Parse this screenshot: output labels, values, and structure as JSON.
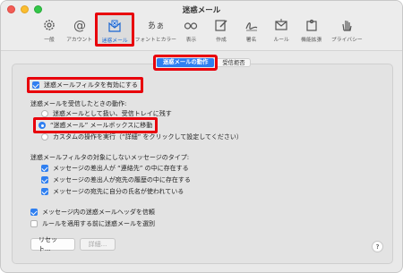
{
  "window": {
    "title": "迷惑メール"
  },
  "toolbar": {
    "items": [
      {
        "label": "一般",
        "icon": "gear-icon"
      },
      {
        "label": "アカウント",
        "icon": "at-sign-icon"
      },
      {
        "label": "迷惑メール",
        "icon": "junk-mail-icon",
        "active": true
      },
      {
        "label": "フォントとカラー",
        "icon": "fonts-icon"
      },
      {
        "label": "表示",
        "icon": "glasses-icon"
      },
      {
        "label": "作成",
        "icon": "compose-icon"
      },
      {
        "label": "署名",
        "icon": "signature-icon"
      },
      {
        "label": "ルール",
        "icon": "rules-icon"
      },
      {
        "label": "機能拡張",
        "icon": "extensions-icon"
      },
      {
        "label": "プライバシー",
        "icon": "hand-icon"
      }
    ]
  },
  "tabs": {
    "active": "迷惑メールの動作",
    "other": "受信拒否"
  },
  "filter": {
    "label": "迷惑メールフィルタを有効にする",
    "checked": true
  },
  "received": {
    "heading": "迷惑メールを受信したときの動作:",
    "options": [
      {
        "label": "迷惑メールとして扱い、受信トレイに残す",
        "selected": false
      },
      {
        "label": "“迷惑メール” メールボックスに移動",
        "selected": true
      },
      {
        "label": "カスタムの操作を実行（“詳細” をクリックして設定してください）",
        "selected": false
      }
    ]
  },
  "exempt": {
    "heading": "迷惑メールフィルタの対象にしないメッセージのタイプ:",
    "options": [
      {
        "label": "メッセージの差出人が “連絡先” の中に存在する",
        "checked": true
      },
      {
        "label": "メッセージの差出人が宛先の履歴の中に存在する",
        "checked": true
      },
      {
        "label": "メッセージの宛先に自分の氏名が使われている",
        "checked": true
      }
    ]
  },
  "extra": {
    "headers": {
      "label": "メッセージ内の迷惑メールヘッダを信頼",
      "checked": true
    },
    "before_rules": {
      "label": "ルールを適用する前に迷惑メールを選別",
      "checked": false
    }
  },
  "buttons": {
    "reset": "リセット...",
    "details": "詳細...",
    "help": "?"
  },
  "colors": {
    "accent": "#2f7ff0",
    "highlight": "#e8000b"
  }
}
